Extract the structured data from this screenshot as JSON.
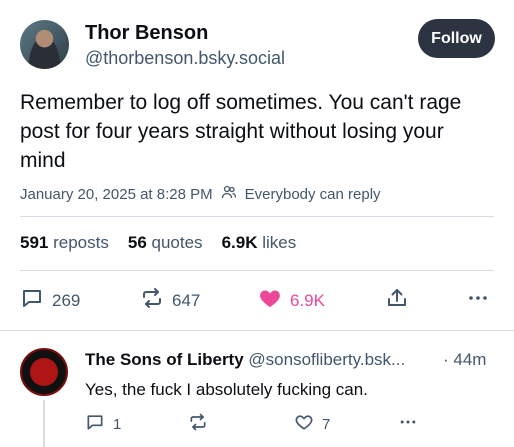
{
  "post": {
    "author_name": "Thor Benson",
    "author_handle": "@thorbenson.bsky.social",
    "follow_label": "Follow",
    "text": "Remember to log off sometimes. You can't rage post for four years straight without losing your mind",
    "timestamp": "January 20, 2025 at 8:28 PM",
    "reply_setting": "Everybody can reply",
    "stats": {
      "reposts_count": "591",
      "reposts_label": "reposts",
      "quotes_count": "56",
      "quotes_label": "quotes",
      "likes_count": "6.9K",
      "likes_label": "likes"
    },
    "actions": {
      "replies": "269",
      "reposts": "647",
      "likes": "6.9K"
    }
  },
  "reply": {
    "author_name": "The Sons of Liberty",
    "author_handle": "@sonsofliberty.bsk...",
    "time": "· 44m",
    "text": "Yes, the fuck I absolutely fucking can.",
    "replies": "1",
    "likes": "7"
  },
  "colors": {
    "like_pink": "#ec4899",
    "muted": "#42576c",
    "follow_bg": "#2b3440"
  },
  "icons": [
    "reply-icon",
    "repost-icon",
    "heart-icon",
    "share-icon",
    "more-icon",
    "people-icon"
  ]
}
